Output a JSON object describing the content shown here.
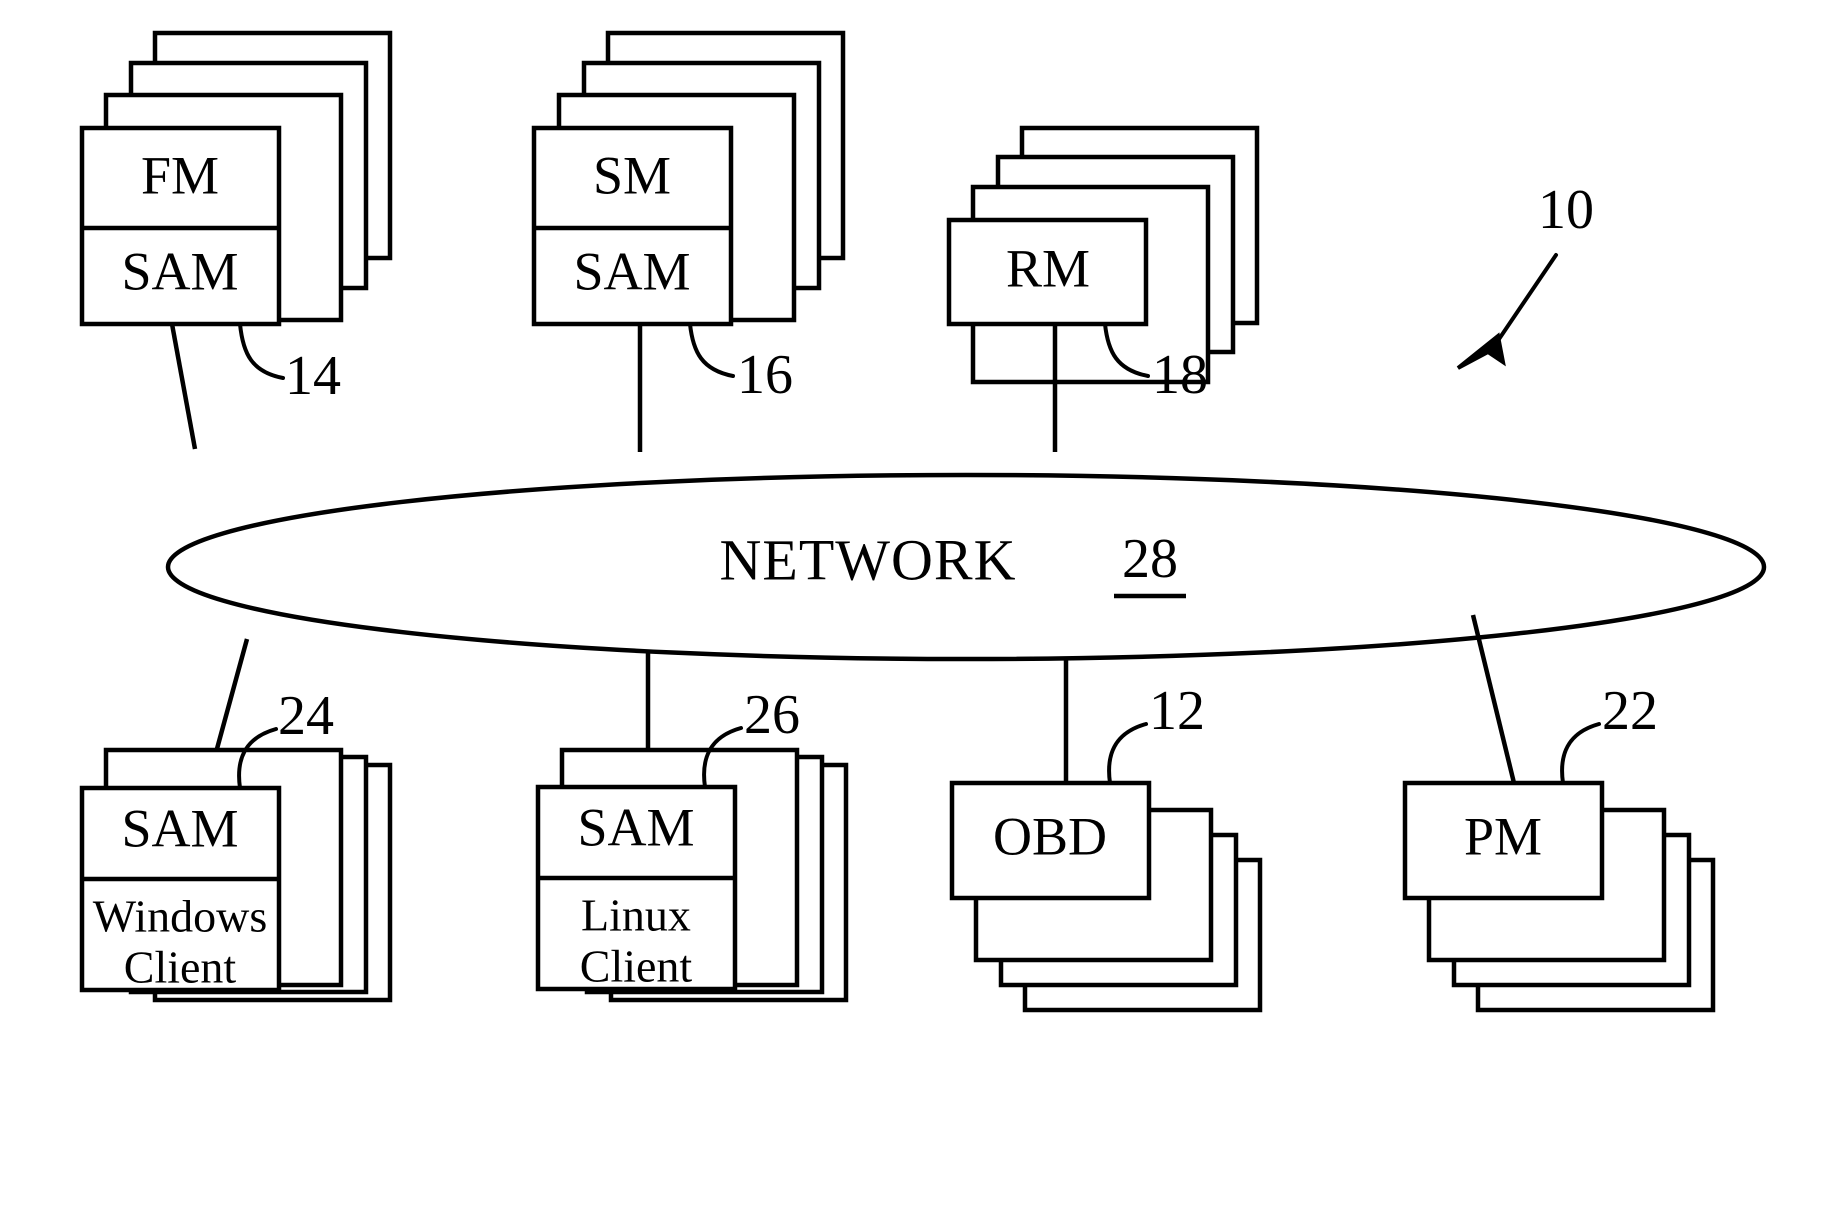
{
  "figure": {
    "figure_reference_number": "10",
    "network": {
      "label": "NETWORK",
      "reference_number": "28"
    },
    "top_nodes": [
      {
        "id": "fm",
        "upper_label": "FM",
        "lower_label": "SAM",
        "reference_number": "14",
        "stack_count": 4
      },
      {
        "id": "sm",
        "upper_label": "SM",
        "lower_label": "SAM",
        "reference_number": "16",
        "stack_count": 4
      },
      {
        "id": "rm",
        "upper_label": "RM",
        "lower_label": "",
        "reference_number": "18",
        "stack_count": 4
      }
    ],
    "bottom_nodes": [
      {
        "id": "windows-client",
        "upper_label": "SAM",
        "lower_label_line1": "Windows",
        "lower_label_line2": "Client",
        "reference_number": "24",
        "stack_count": 4
      },
      {
        "id": "linux-client",
        "upper_label": "SAM",
        "lower_label_line1": "Linux",
        "lower_label_line2": "Client",
        "reference_number": "26",
        "stack_count": 4
      },
      {
        "id": "obd",
        "upper_label": "OBD",
        "lower_label_line1": "",
        "lower_label_line2": "",
        "reference_number": "12",
        "stack_count": 4
      },
      {
        "id": "pm",
        "upper_label": "PM",
        "lower_label_line1": "",
        "lower_label_line2": "",
        "reference_number": "22",
        "stack_count": 4
      }
    ],
    "colors": {
      "ink": "#000000",
      "paper": "#ffffff"
    }
  }
}
